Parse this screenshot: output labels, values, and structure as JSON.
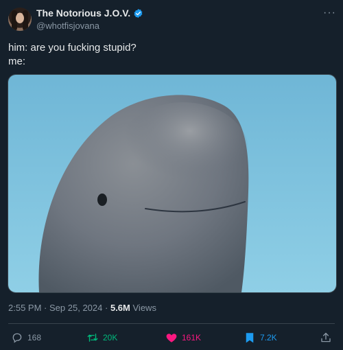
{
  "author": {
    "display_name": "The Notorious J.O.V.",
    "handle": "@whotfisjovana",
    "verified": true
  },
  "more_icon": "more-dots-icon",
  "tweet": {
    "lines": [
      "him: are you fucking stupid?",
      "me:"
    ]
  },
  "media": {
    "type": "image",
    "subject": "beluga whale head against blue water"
  },
  "meta": {
    "time": "2:55 PM",
    "separator": "·",
    "date": "Sep 25, 2024",
    "views_count": "5.6M",
    "views_label": "Views"
  },
  "actions": {
    "reply": {
      "count": "168",
      "icon": "reply-icon"
    },
    "retweet": {
      "count": "20K",
      "icon": "retweet-icon"
    },
    "like": {
      "count": "161K",
      "icon": "heart-icon"
    },
    "bookmark": {
      "count": "7.2K",
      "icon": "bookmark-icon"
    },
    "share": {
      "icon": "share-icon"
    }
  },
  "colors": {
    "background": "#15202b",
    "text": "#e7e9ea",
    "muted": "#8b98a5",
    "verified": "#1d9bf0",
    "retweet": "#00ba7c",
    "like": "#f91880",
    "bookmark": "#1d9bf0"
  }
}
